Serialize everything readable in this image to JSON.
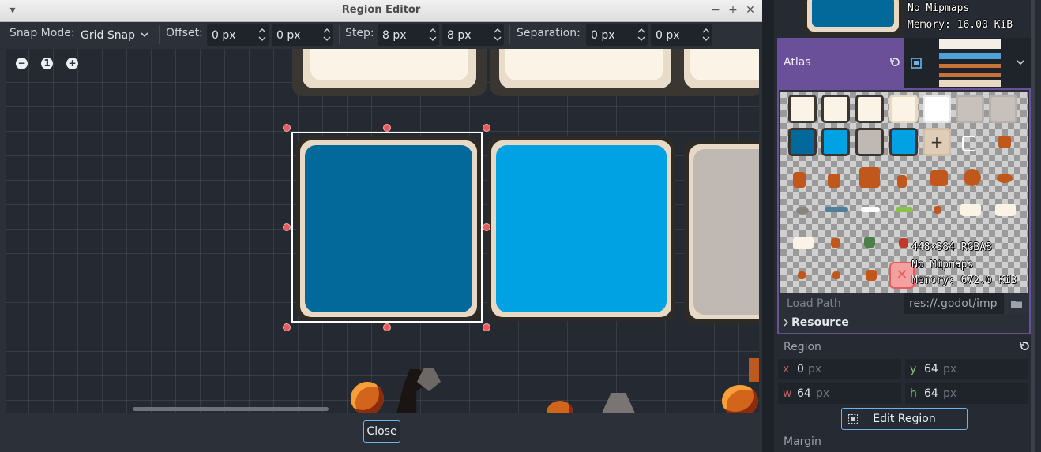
{
  "window": {
    "title": "Region Editor",
    "minimize": "▾",
    "shade": "−",
    "maximize": "+",
    "close": "✕"
  },
  "toolbar": {
    "snap_mode_label": "Snap Mode:",
    "snap_mode_value": "Grid Snap",
    "offset_label": "Offset:",
    "offset_x": "0 px",
    "offset_y": "0 px",
    "step_label": "Step:",
    "step_x": "8 px",
    "step_y": "8 px",
    "separation_label": "Separation:",
    "separation_x": "0 px",
    "separation_y": "0 px"
  },
  "zoom": {
    "out": "−",
    "reset": "1",
    "in": "+"
  },
  "footer": {
    "close_label": "Close"
  },
  "inspector": {
    "preview_info": {
      "mipmaps": "No Mipmaps",
      "memory": "Memory: 16.00 KiB"
    },
    "atlas_label": "Atlas",
    "atlas_info": {
      "size": "448×384 RGBA8",
      "mipmaps": "No Mipmaps",
      "memory": "Memory: 672.0 KiB"
    },
    "load_path_label": "Load Path",
    "load_path_value": "res://.godot/imp",
    "resource_label": "Resource",
    "region_label": "Region",
    "region": {
      "x_label": "x",
      "x": "0",
      "y_label": "y",
      "y": "64",
      "w_label": "w",
      "w": "64",
      "h_label": "h",
      "h": "64",
      "unit": "px"
    },
    "edit_region_label": "Edit Region",
    "margin_label": "Margin"
  },
  "colors": {
    "selected_blue": "#02699a",
    "bright_blue": "#00a2e4",
    "cream": "#fbf3e6",
    "grey_tile": "#bfb8b3",
    "atlas_purple": "#6a4f99",
    "accent": "#6fb3e8",
    "handle_red": "#e65b5b"
  }
}
